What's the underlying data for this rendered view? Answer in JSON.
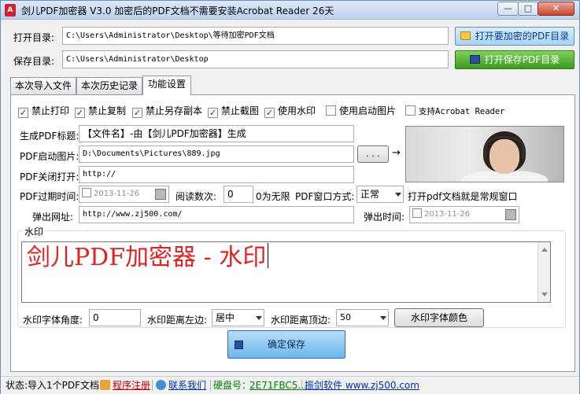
{
  "window": {
    "title": "剑儿PDF加密器  V3.0 加密后的PDF文档不需要安装Acrobat Reader  26天",
    "icon": "pdf-app-icon",
    "min": "—",
    "max": "□",
    "close": "✕"
  },
  "paths": {
    "open_label": "打开目录:",
    "open_value": "C:\\Users\\Administrator\\Desktop\\等待加密PDF文档",
    "open_button": "打开要加密的PDF目录",
    "save_label": "保存目录:",
    "save_value": "C:\\Users\\Administrator\\Desktop",
    "save_button": "打开保存PDF目录"
  },
  "tabs": [
    {
      "label": "本次导入文件",
      "active": false
    },
    {
      "label": "本次历史记录",
      "active": false
    },
    {
      "label": "功能设置",
      "active": true
    }
  ],
  "options": [
    {
      "label": "禁止打印",
      "checked": true
    },
    {
      "label": "禁止复制",
      "checked": true
    },
    {
      "label": "禁止另存副本",
      "checked": true
    },
    {
      "label": "禁止截图",
      "checked": true
    },
    {
      "label": "使用水印",
      "checked": true
    },
    {
      "label": "使用启动图片",
      "checked": false
    },
    {
      "label": "支持Acrobat Reader",
      "checked": false
    }
  ],
  "settings": {
    "title_label": "生成PDF标题:",
    "title_value": "【文件名】-由【剑儿PDF加密器】生成",
    "start_image_label": "PDF启动图片:",
    "start_image_value": "D:\\Documents\\Pictures\\889.jpg",
    "browse_button": ". . .",
    "arrow": "→",
    "close_open_label": "PDF关闭打开:",
    "close_open_value": "http://",
    "expire_label": "PDF过期时间:",
    "expire_value": "2013-11-26",
    "read_count_label": "阅读数次:",
    "read_count_value": "0",
    "read_count_hint": "0为无限",
    "window_mode_label": "PDF窗口方式:",
    "window_mode_value": "正常",
    "window_mode_hint": "打开pdf文档就是常规窗口",
    "popup_url_label": "弹出网址:",
    "popup_url_value": "http://www.zj500.com/",
    "popup_time_label": "弹出时间:",
    "popup_time_value": "2013-11-26"
  },
  "watermark": {
    "group_title": "水印",
    "text": "剑儿PDF加密器 - 水印",
    "angle_label": "水印字体角度:",
    "angle_value": "0",
    "left_label": "水印距离左边:",
    "left_value": "居中",
    "top_label": "水印距离顶边:",
    "top_value": "50",
    "color_button": "水印字体颜色"
  },
  "save_button": "确定保存",
  "status": {
    "imported": "状态:导入1个PDF文档",
    "register": "程序注册",
    "contact": "联系我们",
    "disk_label": "硬盘号：",
    "disk_value": "2E71FBC5...",
    "website": "振剑软件 www.zj500.com"
  },
  "colors": {
    "watermark_text": "#e02222",
    "link_red": "#c00000",
    "link_blue": "#0033aa",
    "disk_green": "#008000",
    "green_button": "#3c9a1d"
  }
}
